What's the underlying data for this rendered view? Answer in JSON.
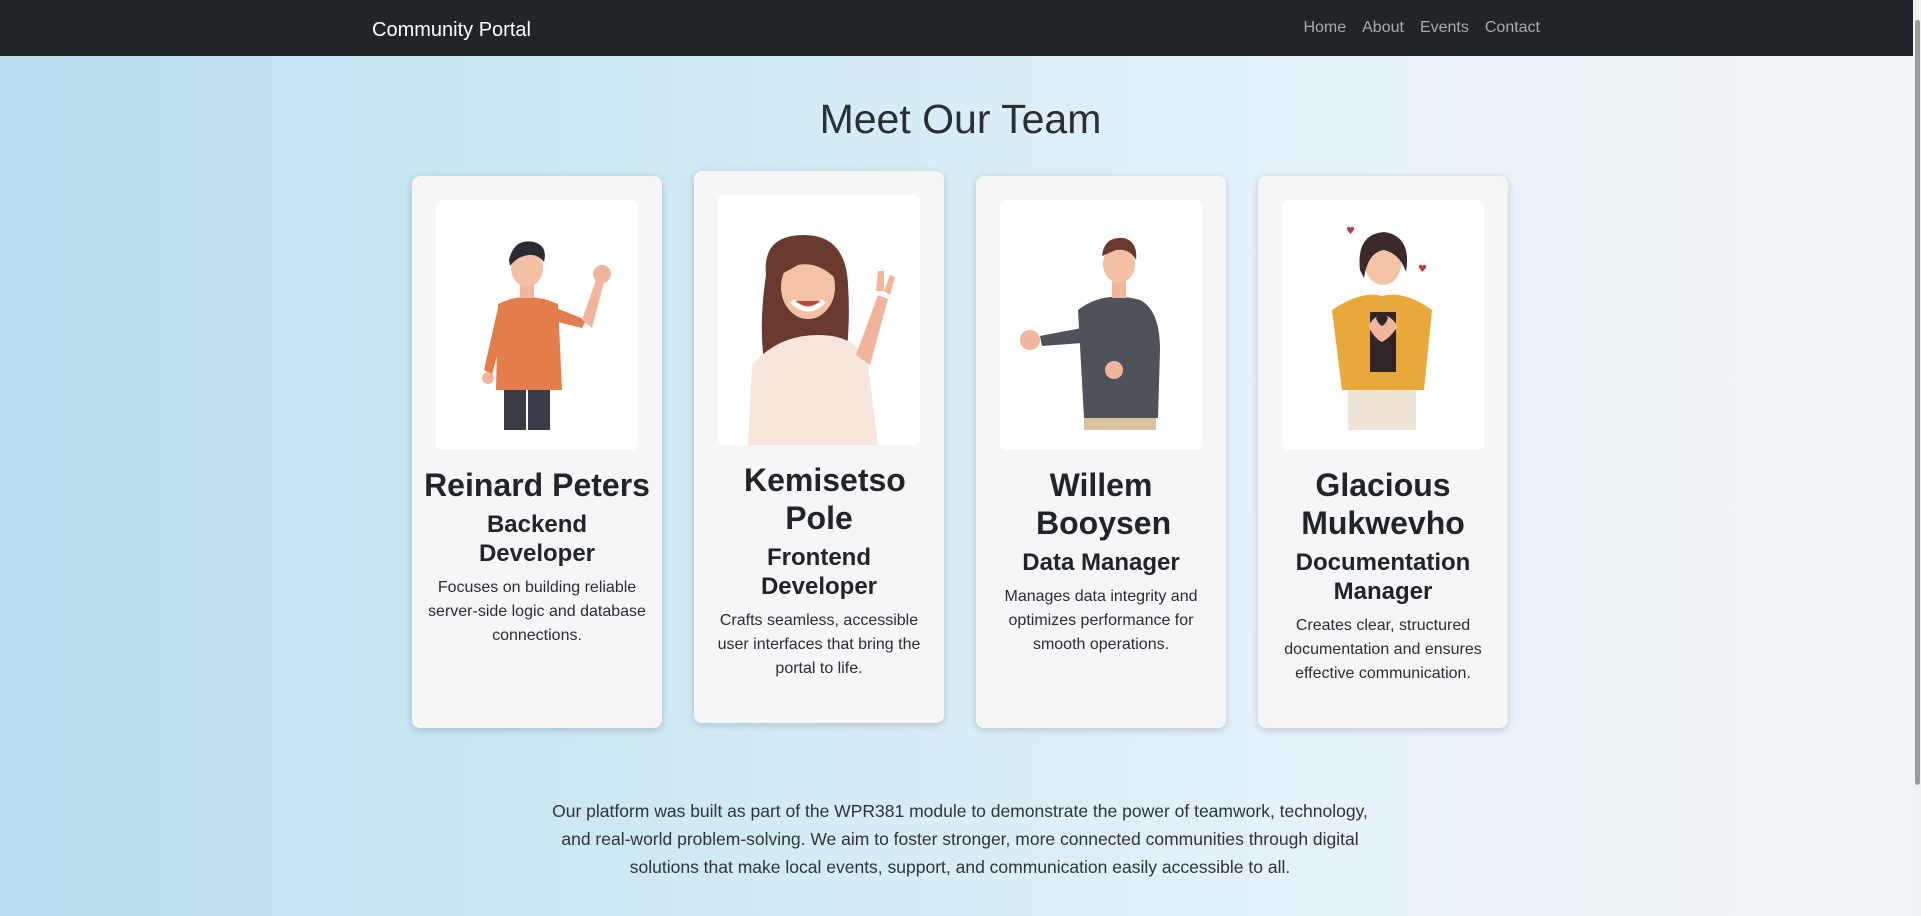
{
  "navbar": {
    "brand": "Community Portal",
    "links": [
      "Home",
      "About",
      "Events",
      "Contact"
    ]
  },
  "page": {
    "title": "Meet Our Team"
  },
  "team": [
    {
      "name": "Reinard Peters",
      "role": "Backend Developer",
      "description": "Focuses on building reliable server-side logic and database connections."
    },
    {
      "name": "Kemisetso Pole",
      "role": "Frontend Developer",
      "description": "Crafts seamless, accessible user interfaces that bring the portal to life."
    },
    {
      "name": "Willem Booysen",
      "role": "Data Manager",
      "description": "Manages data integrity and optimizes performance for smooth operations."
    },
    {
      "name": "Glacious Mukwevho",
      "role": "Documentation Manager",
      "description": "Creates clear, structured documentation and ensures effective communication."
    }
  ],
  "about": {
    "text": "Our platform was built as part of the WPR381 module to demonstrate the power of teamwork, technology, and real-world problem-solving. We aim to foster stronger, more connected communities through digital solutions that make local events, support, and communication easily accessible to all."
  },
  "colors": {
    "navbar_bg": "#212529",
    "card_bg": "#f6f6f6",
    "gradient_start": "#b7dff0",
    "gradient_end": "#f3f6f8"
  }
}
